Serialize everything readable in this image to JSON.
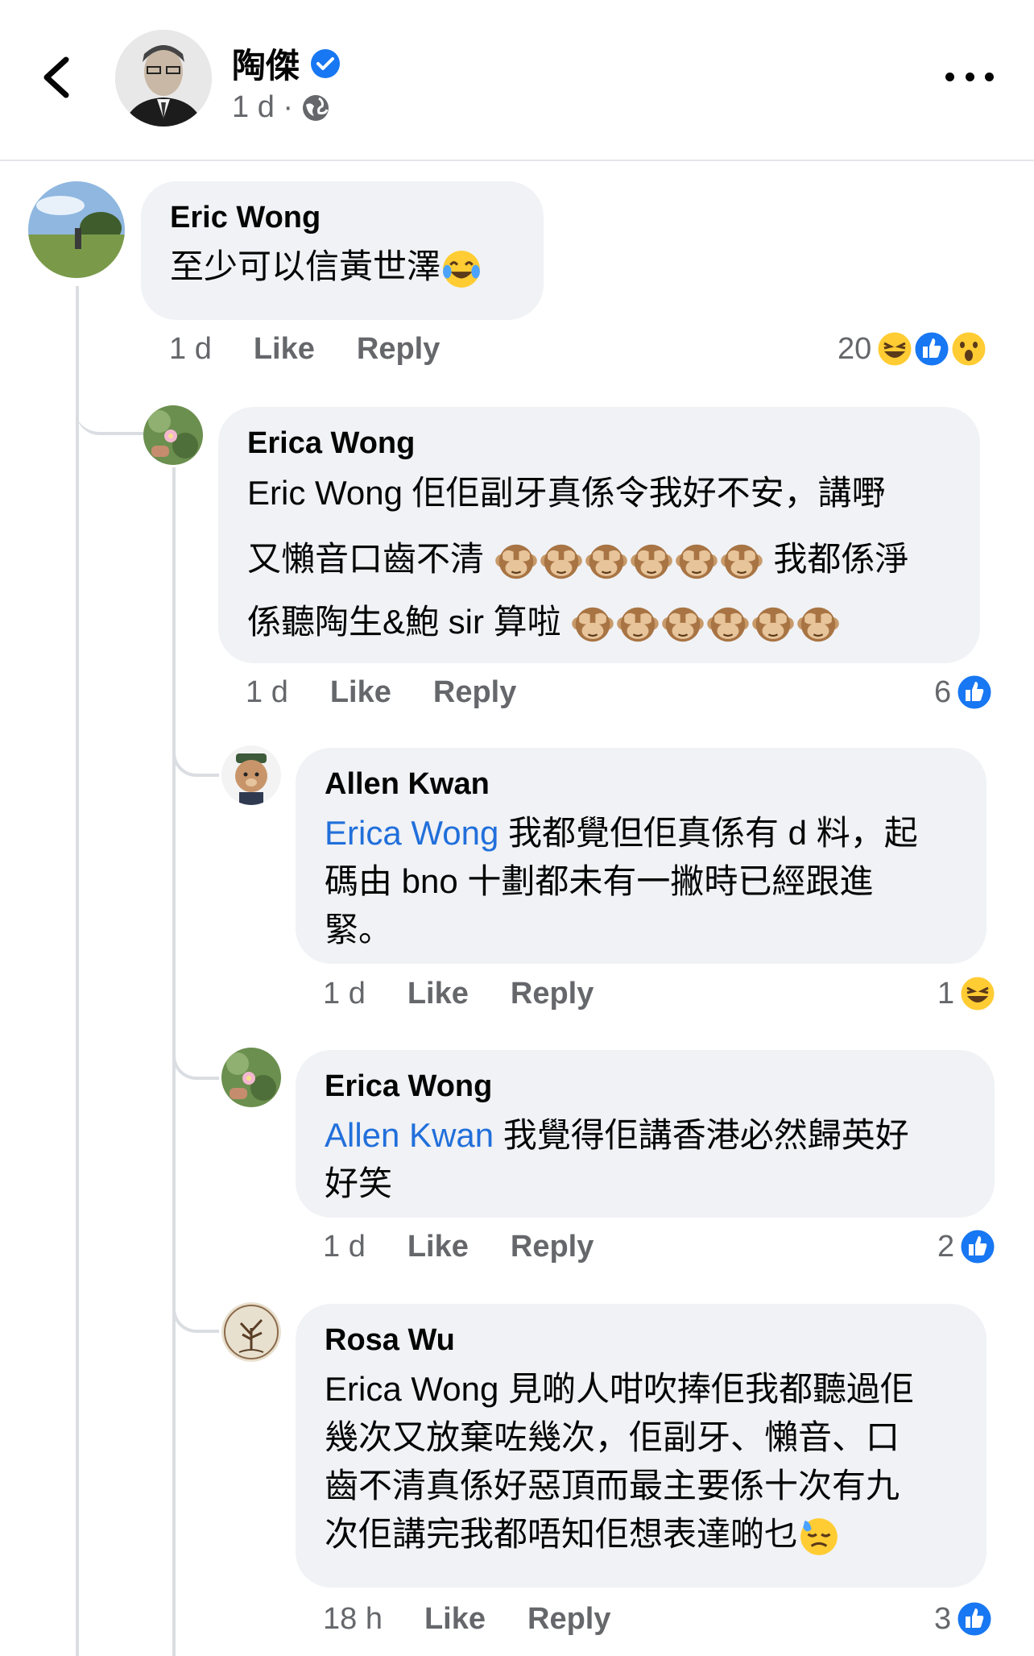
{
  "header": {
    "name": "陶傑",
    "time": "1 d ·"
  },
  "comments": [
    {
      "author": "Eric Wong",
      "text": "至少可以信黃世澤",
      "time": "1 d",
      "like": "Like",
      "reply": "Reply",
      "reaction_count": "20",
      "reactions": [
        "haha-icon",
        "like-icon",
        "wow-icon"
      ]
    },
    {
      "author": "Erica Wong",
      "text_line1": "Eric Wong  佢佢副牙真係令我好不安，講嘢",
      "text_line2": "又懶音口齒不清",
      "text_line2b": "我都係淨",
      "text_line3": "係聽陶生&鮑 sir 算啦",
      "time": "1 d",
      "like": "Like",
      "reply": "Reply",
      "reaction_count": "6",
      "reactions": [
        "like-icon"
      ]
    },
    {
      "author": "Allen Kwan",
      "mention": "Erica Wong",
      "text_a": " 我都覺但佢真係有 d 料，起",
      "text_b": "碼由 bno 十劃都未有一撇時已經跟進",
      "text_c": "緊。",
      "time": "1 d",
      "like": "Like",
      "reply": "Reply",
      "reaction_count": "1",
      "reactions": [
        "haha-icon"
      ]
    },
    {
      "author": "Erica Wong",
      "mention": "Allen Kwan",
      "text_a": "  我覺得佢講香港必然歸英好",
      "text_b": "好笑",
      "time": "1 d",
      "like": "Like",
      "reply": "Reply",
      "reaction_count": "2",
      "reactions": [
        "like-icon"
      ]
    },
    {
      "author": "Rosa Wu",
      "text_a": "Erica Wong 見啲人咁吹捧佢我都聽過佢",
      "text_b": "幾次又放棄咗幾次，佢副牙、懶音、口",
      "text_c": "齒不清真係好惡頂而最主要係十次有九",
      "text_d": "次佢講完我都唔知佢想表達啲乜",
      "time": "18 h",
      "like": "Like",
      "reply": "Reply",
      "reaction_count": "3",
      "reactions": [
        "like-icon"
      ]
    }
  ],
  "colors": {
    "link": "#216fdb",
    "meta": "#65676b",
    "bubble": "#f0f2f5",
    "like": "#1877f2"
  }
}
